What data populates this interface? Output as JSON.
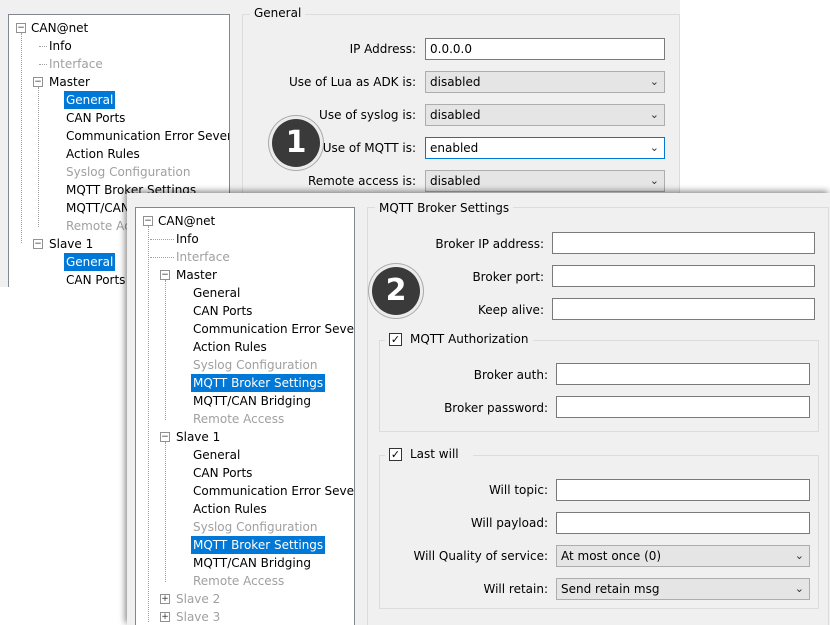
{
  "colors": {
    "selection": "#0078d7",
    "disabled_text": "#a0a0a0",
    "badge": "#3a3a3a",
    "panel": "#f0f0f0"
  },
  "screen1": {
    "tree": {
      "root": "CAN@net",
      "info": "Info",
      "interface": "Interface",
      "master": {
        "label": "Master",
        "items": [
          "General",
          "CAN Ports",
          "Communication Error Severity",
          "Action Rules",
          "Syslog Configuration",
          "MQTT Broker Settings",
          "MQTT/CAN",
          "Remote Acce"
        ]
      },
      "slave1": {
        "label": "Slave 1",
        "items": [
          "General",
          "CAN Ports"
        ]
      }
    },
    "group_title": "General",
    "badge": "1",
    "fields": {
      "ip_label": "IP Address:",
      "ip_value": "0.0.0.0",
      "lua_label": "Use of Lua as ADK is:",
      "lua_value": "disabled",
      "syslog_label": "Use of syslog is:",
      "syslog_value": "disabled",
      "mqtt_label": "Use of MQTT is:",
      "mqtt_value": "enabled",
      "remote_label": "Remote access is:",
      "remote_value": "disabled"
    }
  },
  "screen2": {
    "tree": {
      "root": "CAN@net",
      "info": "Info",
      "interface": "Interface",
      "master": {
        "label": "Master",
        "items": [
          "General",
          "CAN Ports",
          "Communication Error Severity",
          "Action Rules",
          "Syslog Configuration",
          "MQTT Broker Settings",
          "MQTT/CAN Bridging",
          "Remote Access"
        ]
      },
      "slave1": {
        "label": "Slave 1",
        "items": [
          "General",
          "CAN Ports",
          "Communication Error Severity",
          "Action Rules",
          "Syslog Configuration",
          "MQTT Broker Settings",
          "MQTT/CAN Bridging",
          "Remote Access"
        ]
      },
      "slave2": "Slave 2",
      "slave3": "Slave 3"
    },
    "group_title": "MQTT Broker Settings",
    "badge": "2",
    "fields": {
      "broker_ip_label": "Broker IP address:",
      "broker_ip_value": "",
      "broker_port_label": "Broker port:",
      "broker_port_value": "",
      "keep_alive_label": "Keep alive:",
      "keep_alive_value": ""
    },
    "auth": {
      "title": "MQTT Authorization",
      "checked": true,
      "broker_auth_label": "Broker auth:",
      "broker_auth_value": "",
      "broker_password_label": "Broker password:",
      "broker_password_value": ""
    },
    "lastwill": {
      "title": "Last will",
      "checked": true,
      "topic_label": "Will topic:",
      "topic_value": "",
      "payload_label": "Will payload:",
      "payload_value": "",
      "qos_label": "Will Quality of service:",
      "qos_value": "At most once (0)",
      "retain_label": "Will retain:",
      "retain_value": "Send retain msg"
    }
  }
}
